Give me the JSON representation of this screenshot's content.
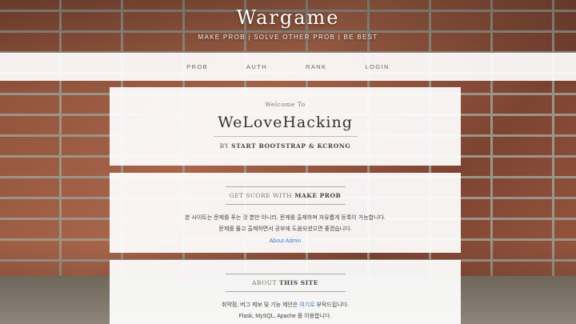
{
  "header": {
    "title": "Wargame",
    "tagline": "MAKE PROB | SOLVE OTHER PROB | BE BEST"
  },
  "nav": {
    "items": [
      {
        "label": "PROB"
      },
      {
        "label": "AUTH"
      },
      {
        "label": "RANK"
      },
      {
        "label": "LOGIN"
      }
    ]
  },
  "intro": {
    "welcome": "Welcome To",
    "brand": "WeLoveHacking",
    "by_prefix": "BY",
    "by_authors": "START BOOTSTRAP & KCRONG"
  },
  "score_section": {
    "heading_prefix": "GET SCORE WITH",
    "heading_bold": "MAKE PROB",
    "line1": "본 사이트는 문제를 푸는 것 뿐만 아니라, 문제를 출제하며 자유롭게 등록이 가능합니다.",
    "line2": "문제를 풀고 출제하면서 공부에 도움되셨으면 좋겠습니다.",
    "link_label": "About Admin"
  },
  "about_section": {
    "heading_prefix": "ABOUT",
    "heading_bold": "THIS SITE",
    "line1_before": "취약점, 버그 제보 및 기능 제안은 ",
    "line1_link": "여기로",
    "line1_after": " 부탁드립니다.",
    "line2": "Flask, MySQL, Apache 를 이용합니다."
  }
}
